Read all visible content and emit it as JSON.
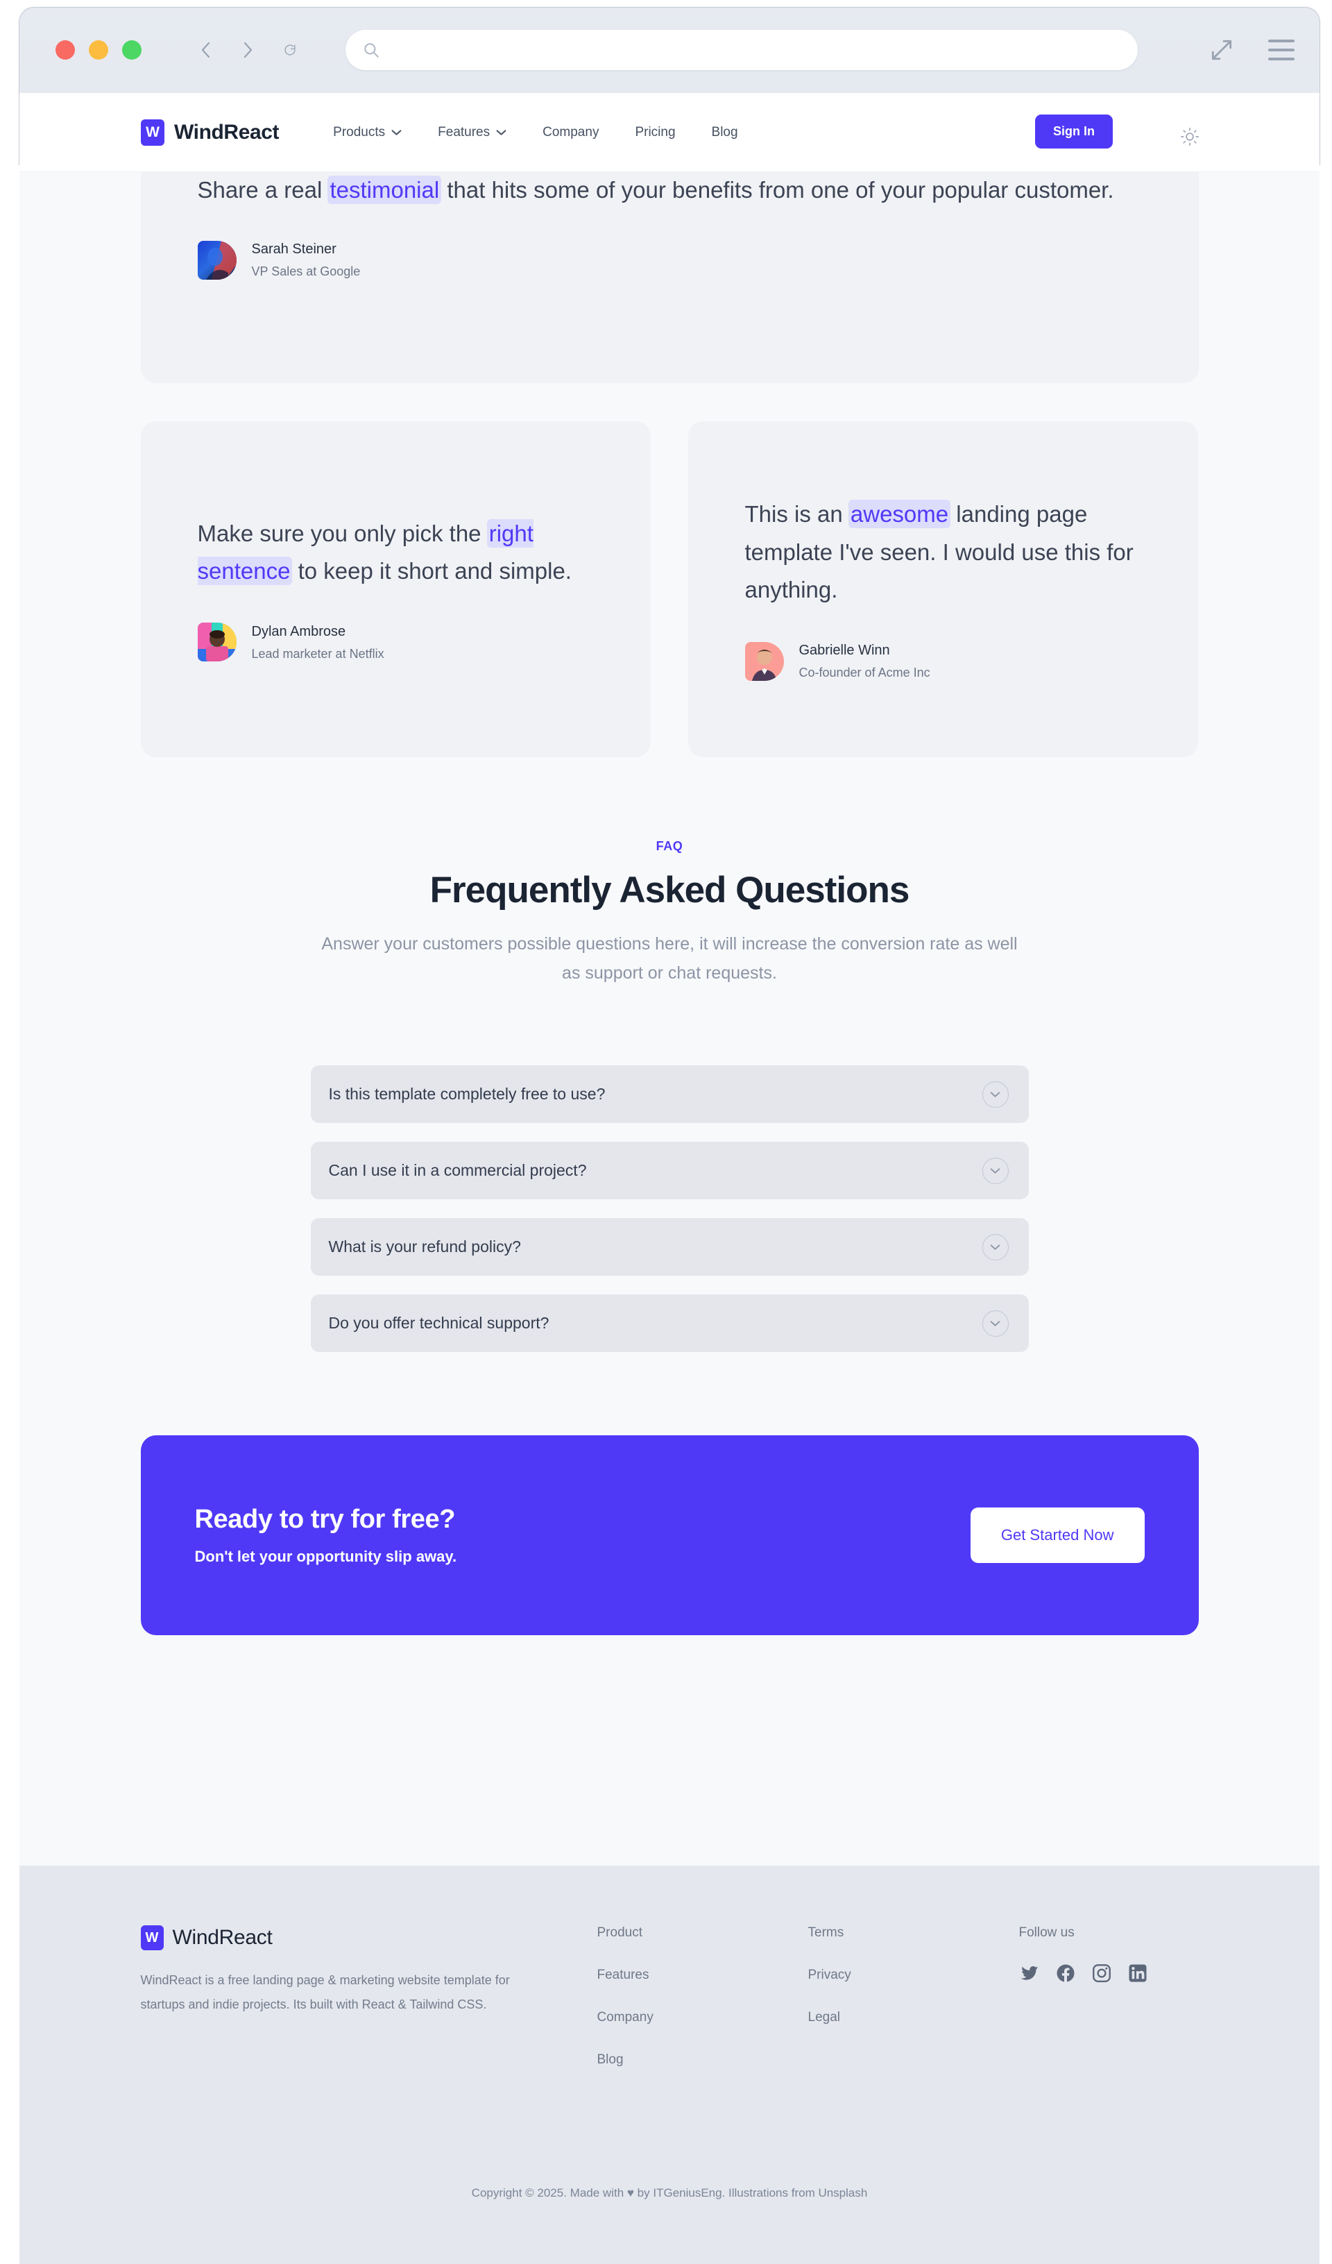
{
  "browser": {
    "url_value": "",
    "url_placeholder": "",
    "search_icon": "search-icon",
    "back_icon": "chevron-left-icon",
    "forward_icon": "chevron-right-icon",
    "reload_icon": "reload-icon",
    "expand_icon": "expand-arrows-icon",
    "menu_icon": "hamburger-menu-icon",
    "traffic_colors": {
      "red": "#f96a62",
      "yellow": "#fcbc40",
      "green": "#4cd764"
    }
  },
  "nav": {
    "logo_letter": "W",
    "brand": "WindReact",
    "links": [
      {
        "label": "Products",
        "has_caret": true
      },
      {
        "label": "Features",
        "has_caret": true
      },
      {
        "label": "Company",
        "has_caret": false
      },
      {
        "label": "Pricing",
        "has_caret": false
      },
      {
        "label": "Blog",
        "has_caret": false
      }
    ],
    "sign_in": "Sign In",
    "theme_icon": "sun-icon",
    "accent": "#4f39f6"
  },
  "testimonials": {
    "wide": {
      "quote_before": "Share a real ",
      "quote_highlight": "testimonial",
      "quote_after": " that hits some of your benefits from one of your popular customer.",
      "name": "Sarah Steiner",
      "role": "VP Sales at Google"
    },
    "cards": [
      {
        "quote_before": "Make sure you only pick the ",
        "quote_highlight": "right sentence",
        "quote_after": " to keep it short and simple.",
        "name": "Dylan Ambrose",
        "role": "Lead marketer at Netflix"
      },
      {
        "quote_before": "This is an ",
        "quote_highlight": "awesome",
        "quote_after": " landing page template I've seen. I would use this for anything.",
        "name": "Gabrielle Winn",
        "role": "Co-founder of Acme Inc"
      }
    ]
  },
  "faq": {
    "eyebrow": "FAQ",
    "title": "Frequently Asked Questions",
    "subtitle": "Answer your customers possible questions here, it will increase the conversion rate as well as support or chat requests.",
    "items": [
      {
        "question": "Is this template completely free to use?"
      },
      {
        "question": "Can I use it in a commercial project?"
      },
      {
        "question": "What is your refund policy?"
      },
      {
        "question": "Do you offer technical support?"
      }
    ],
    "chevron_icon": "chevron-down-icon"
  },
  "cta": {
    "title": "Ready to try for free?",
    "subtitle": "Don't let your opportunity slip away.",
    "button": "Get Started Now",
    "background": "#4f39f6"
  },
  "footer": {
    "logo_letter": "W",
    "brand": "WindReact",
    "description": "WindReact is a free landing page & marketing website template for startups and indie projects. Its built with React & Tailwind CSS.",
    "columns": [
      {
        "links": [
          "Product",
          "Features",
          "Company",
          "Blog"
        ]
      },
      {
        "links": [
          "Terms",
          "Privacy",
          "Legal"
        ]
      }
    ],
    "social_heading": "Follow us",
    "social": [
      "twitter-icon",
      "facebook-icon",
      "instagram-icon",
      "linkedin-icon"
    ],
    "copyright": "Copyright © 2025. Made with ♥ by ITGeniusEng. Illustrations from Unsplash"
  }
}
